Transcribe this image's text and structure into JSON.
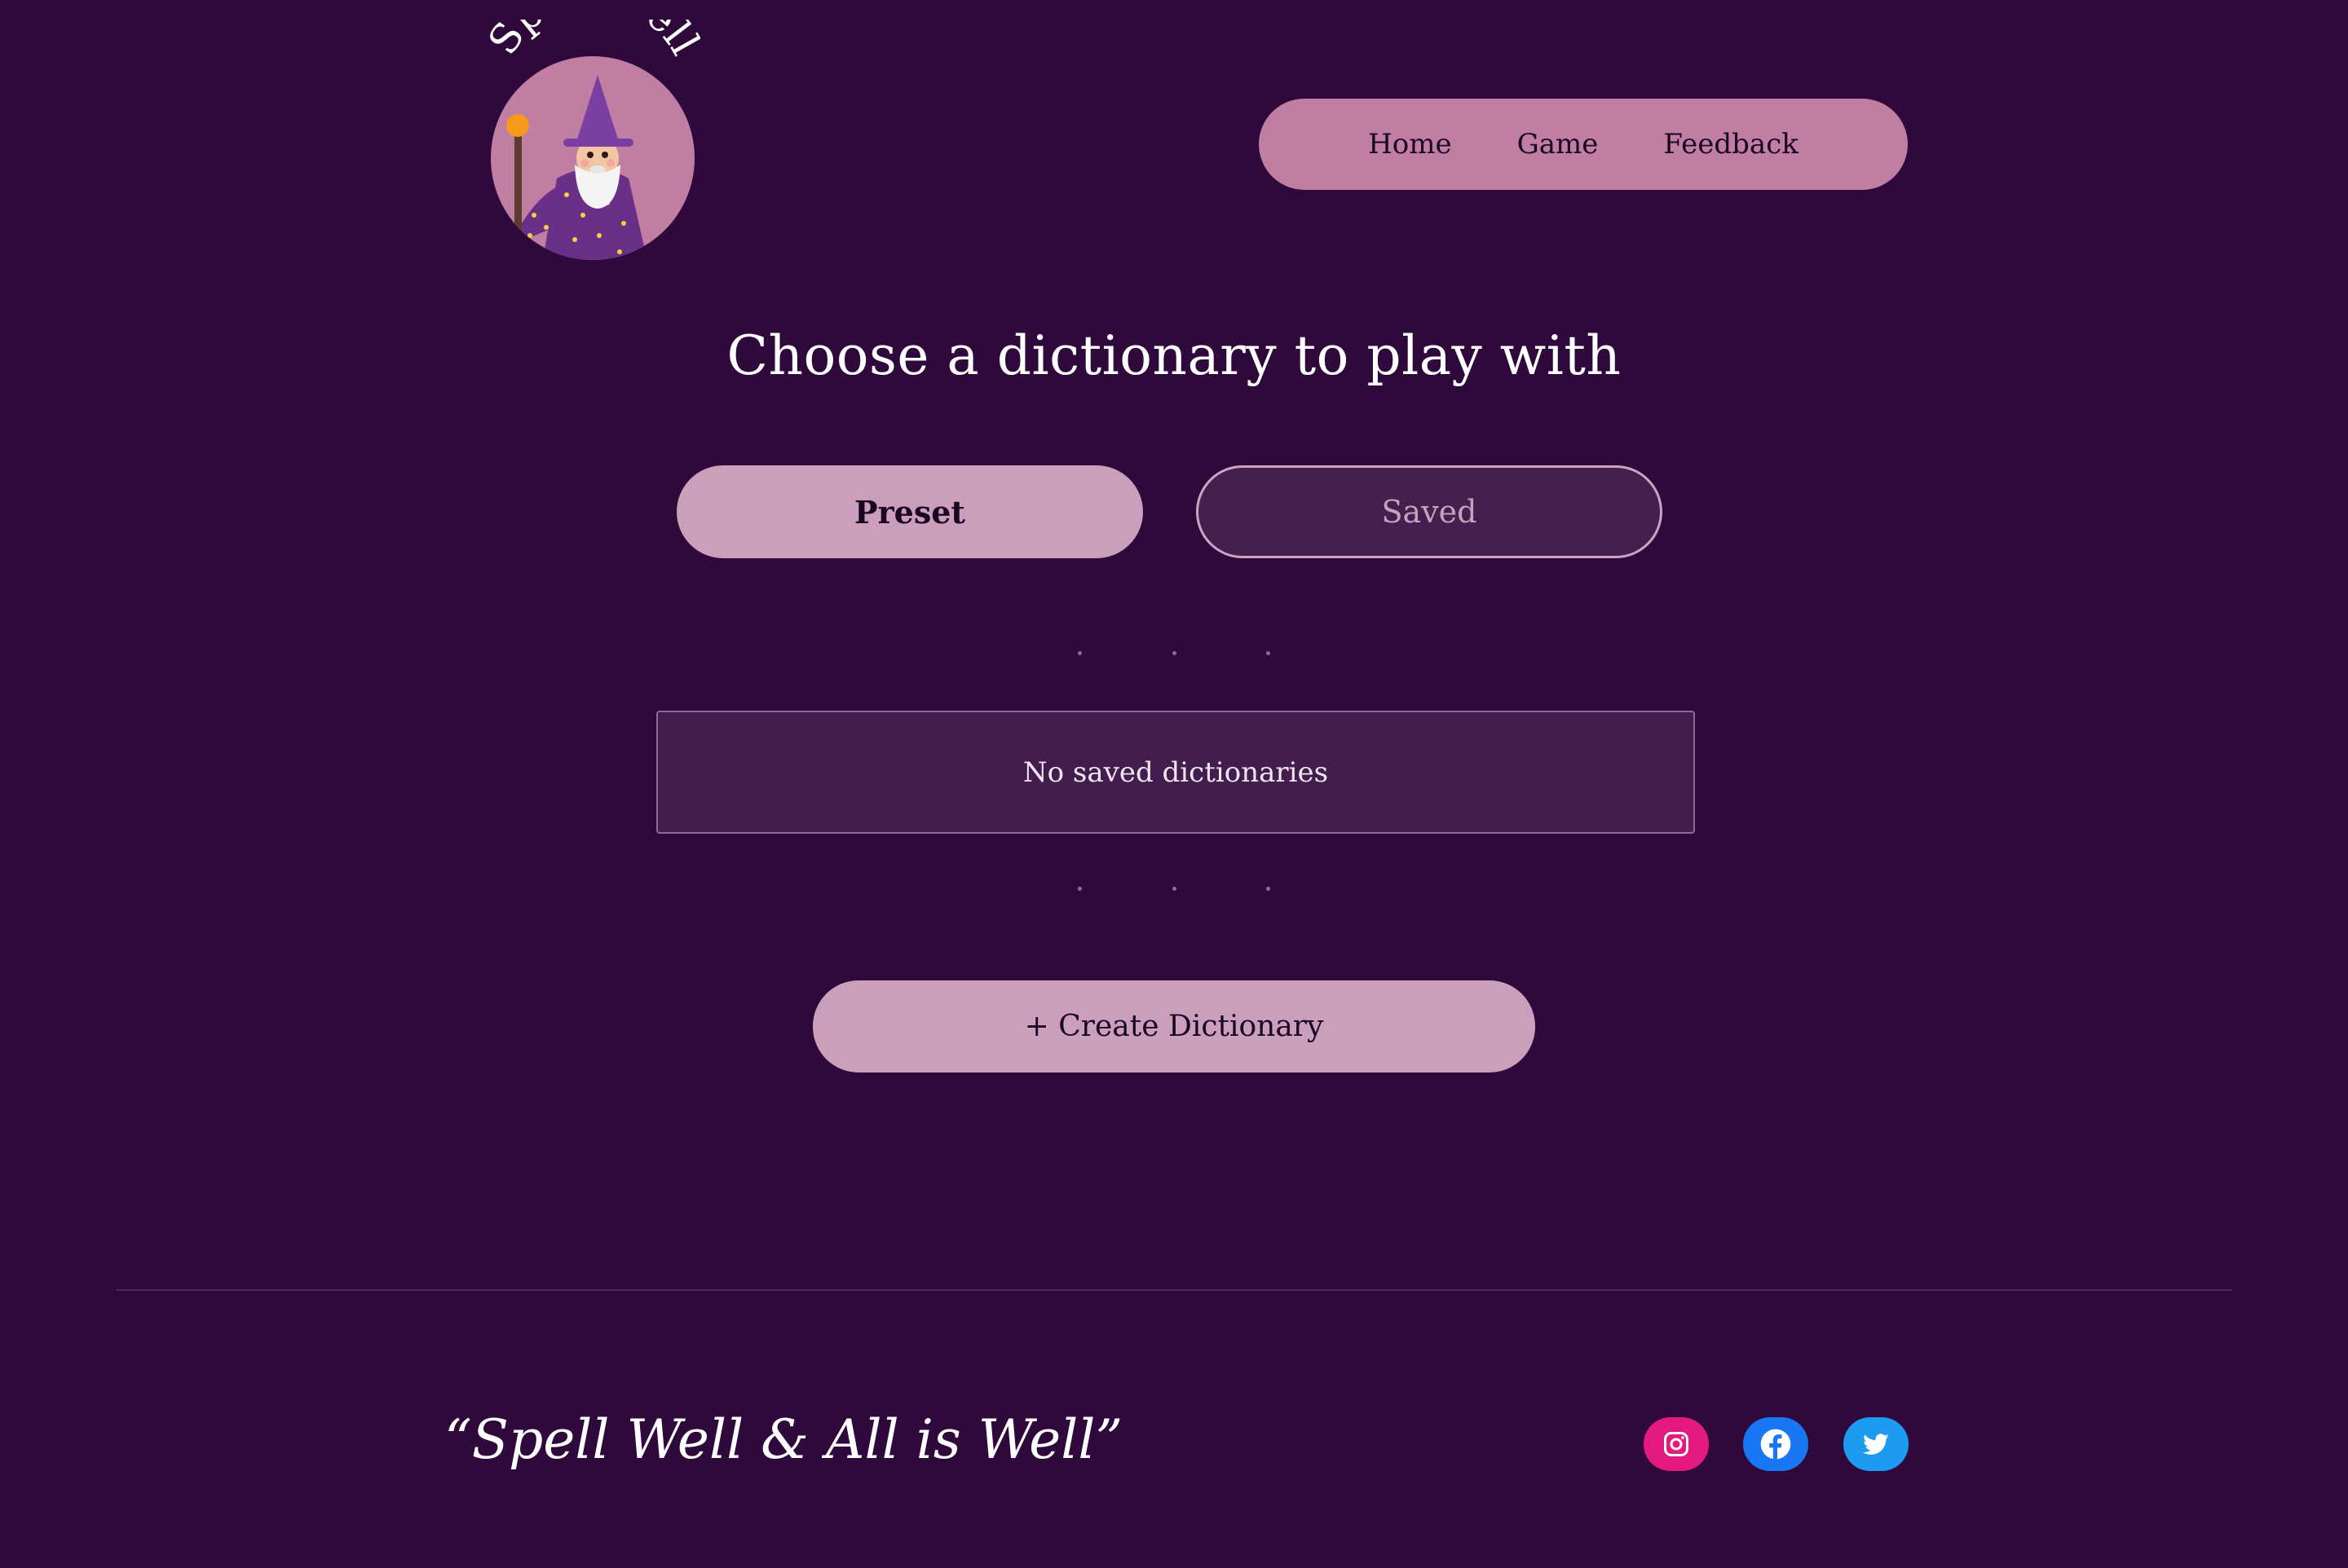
{
  "header": {
    "logo_text": "Spell Well",
    "nav": [
      {
        "label": "Home"
      },
      {
        "label": "Game"
      },
      {
        "label": "Feedback"
      }
    ]
  },
  "main": {
    "title": "Choose a dictionary to play with",
    "toggle": {
      "preset_label": "Preset",
      "saved_label": "Saved",
      "selected": "Saved"
    },
    "saved_list": {
      "empty_message": "No saved dictionaries"
    },
    "create_button_label": "+ Create Dictionary"
  },
  "footer": {
    "tagline": "“Spell Well & All is Well”",
    "social": [
      {
        "icon": "instagram-icon",
        "color": "#e51a7e"
      },
      {
        "icon": "facebook-icon",
        "color": "#1877f2"
      },
      {
        "icon": "twitter-icon",
        "color": "#1d9bf0"
      }
    ]
  },
  "colors": {
    "background": "#2f093c",
    "nav_pill": "#c07ea2",
    "button_pink": "#cb9fbc",
    "panel": "#431d4e"
  }
}
